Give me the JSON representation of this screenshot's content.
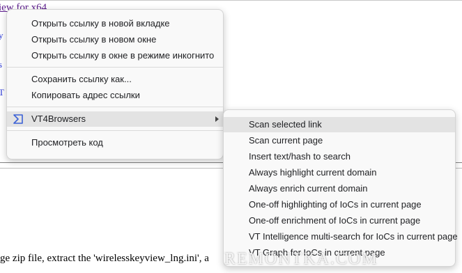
{
  "background": {
    "top_link": "iew for x64",
    "fragments": [
      "y",
      "s",
      "T"
    ],
    "bottom_text": "ge zip file, extract the 'wirelesskeyview_lng.ini', a"
  },
  "context_menu": {
    "items": [
      {
        "label": "Открыть ссылку в новой вкладке"
      },
      {
        "label": "Открыть ссылку в новом окне"
      },
      {
        "label": "Открыть ссылку в окне в режиме инкогнито"
      },
      {
        "label": "Сохранить ссылку как..."
      },
      {
        "label": "Копировать адрес ссылки"
      },
      {
        "label": "VT4Browsers",
        "icon": "vt4browsers-icon",
        "has_submenu": true
      },
      {
        "label": "Просмотреть код"
      }
    ]
  },
  "submenu": {
    "items": [
      {
        "label": "Scan selected link",
        "highlighted": true
      },
      {
        "label": "Scan current page"
      },
      {
        "label": "Insert text/hash to search"
      },
      {
        "label": "Always highlight current domain"
      },
      {
        "label": "Always enrich current domain"
      },
      {
        "label": "One-off highlighting of IoCs in current page"
      },
      {
        "label": "One-off enrichment of IoCs in current page"
      },
      {
        "label": "VT Intelligence multi-search for IoCs in current page"
      },
      {
        "label": "VT Graph for IoCs in current page"
      }
    ]
  },
  "watermark": "REMONTKA.COM",
  "colors": {
    "menu_bg": "#f9f9f9",
    "highlight": "#e3e3e3",
    "vt_icon": "#3b61d6",
    "link": "#5a1a8b"
  }
}
